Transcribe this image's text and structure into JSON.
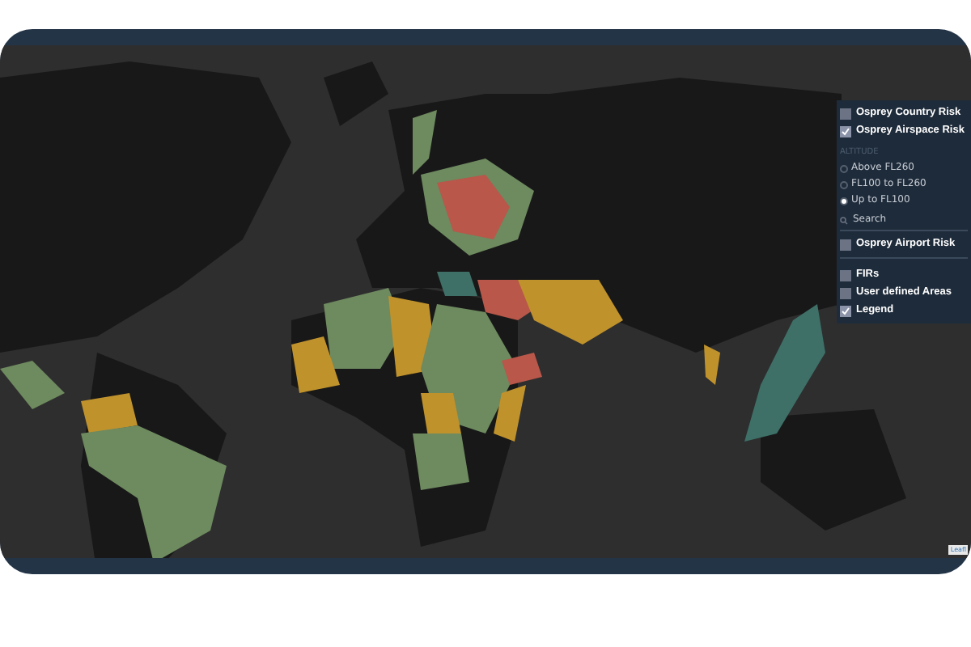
{
  "layer_panel": {
    "risk_layers": [
      {
        "label": "Osprey Country Risk",
        "checked": false
      },
      {
        "label": "Osprey Airspace Risk",
        "checked": true
      }
    ],
    "altitude": {
      "heading": "ALTITUDE",
      "options": [
        {
          "label": "Above FL260",
          "selected": false
        },
        {
          "label": "FL100 to FL260",
          "selected": false
        },
        {
          "label": "Up to FL100",
          "selected": true
        }
      ]
    },
    "search": {
      "placeholder": "Search"
    },
    "airport_layer": {
      "label": "Osprey Airport Risk",
      "checked": false
    },
    "overlays": [
      {
        "label": "FIRs",
        "checked": false
      },
      {
        "label": "User defined Areas",
        "checked": false
      },
      {
        "label": "Legend",
        "checked": true
      }
    ]
  },
  "attribution": "Leafl"
}
